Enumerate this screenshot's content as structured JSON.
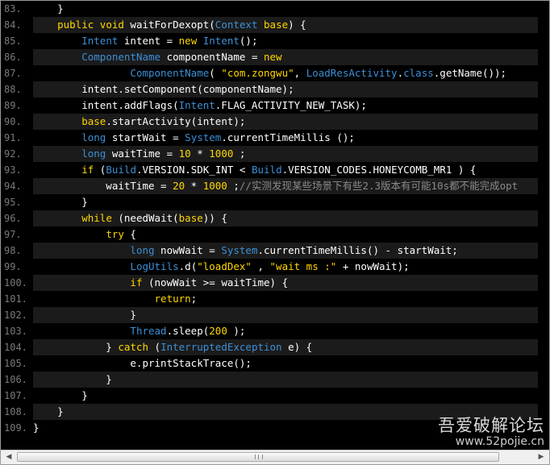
{
  "code": {
    "lines": [
      {
        "num": "83.",
        "tokens": [
          [
            "p",
            "    }"
          ]
        ]
      },
      {
        "num": "84.",
        "tokens": [
          [
            "p",
            "    "
          ],
          [
            "k",
            "public"
          ],
          [
            "p",
            " "
          ],
          [
            "k",
            "void"
          ],
          [
            "p",
            " waitForDexopt("
          ],
          [
            "t",
            "Context"
          ],
          [
            "p",
            " "
          ],
          [
            "k",
            "base"
          ],
          [
            "p",
            ") {"
          ]
        ]
      },
      {
        "num": "85.",
        "tokens": [
          [
            "p",
            "        "
          ],
          [
            "t",
            "Intent"
          ],
          [
            "p",
            " intent = "
          ],
          [
            "k",
            "new"
          ],
          [
            "p",
            " "
          ],
          [
            "t",
            "Intent"
          ],
          [
            "p",
            "();"
          ]
        ]
      },
      {
        "num": "86.",
        "tokens": [
          [
            "p",
            "        "
          ],
          [
            "t",
            "ComponentName"
          ],
          [
            "p",
            " componentName = "
          ],
          [
            "k",
            "new"
          ]
        ]
      },
      {
        "num": "87.",
        "tokens": [
          [
            "p",
            "                "
          ],
          [
            "t",
            "ComponentName"
          ],
          [
            "p",
            "( "
          ],
          [
            "s",
            "\"com.zongwu\""
          ],
          [
            "p",
            ", "
          ],
          [
            "t",
            "LoadResActivity"
          ],
          [
            "p",
            "."
          ],
          [
            "t",
            "class"
          ],
          [
            "p",
            ".getName());"
          ]
        ]
      },
      {
        "num": "88.",
        "tokens": [
          [
            "p",
            "        intent.setComponent(componentName);"
          ]
        ]
      },
      {
        "num": "89.",
        "tokens": [
          [
            "p",
            "        intent.addFlags("
          ],
          [
            "t",
            "Intent"
          ],
          [
            "p",
            ".FLAG_ACTIVITY_NEW_TASK);"
          ]
        ]
      },
      {
        "num": "90.",
        "tokens": [
          [
            "p",
            "        "
          ],
          [
            "k",
            "base"
          ],
          [
            "p",
            ".startActivity(intent);"
          ]
        ]
      },
      {
        "num": "91.",
        "tokens": [
          [
            "p",
            "        "
          ],
          [
            "t",
            "long"
          ],
          [
            "p",
            " startWait = "
          ],
          [
            "t",
            "System"
          ],
          [
            "p",
            ".currentTimeMillis ();"
          ]
        ]
      },
      {
        "num": "92.",
        "tokens": [
          [
            "p",
            "        "
          ],
          [
            "t",
            "long"
          ],
          [
            "p",
            " waitTime = "
          ],
          [
            "n",
            "10"
          ],
          [
            "p",
            " * "
          ],
          [
            "n",
            "1000"
          ],
          [
            "p",
            " ;"
          ]
        ]
      },
      {
        "num": "93.",
        "tokens": [
          [
            "p",
            "        "
          ],
          [
            "k",
            "if"
          ],
          [
            "p",
            " ("
          ],
          [
            "t",
            "Build"
          ],
          [
            "p",
            ".VERSION.SDK_INT < "
          ],
          [
            "t",
            "Build"
          ],
          [
            "p",
            ".VERSION_CODES.HONEYCOMB_MR1 ) {"
          ]
        ]
      },
      {
        "num": "94.",
        "tokens": [
          [
            "p",
            "            waitTime = "
          ],
          [
            "n",
            "20"
          ],
          [
            "p",
            " * "
          ],
          [
            "n",
            "1000"
          ],
          [
            "p",
            " ;"
          ],
          [
            "c",
            "//实测发现某些场景下有些2.3版本有可能10s都不能完成opt"
          ]
        ]
      },
      {
        "num": "95.",
        "tokens": [
          [
            "p",
            "        }"
          ]
        ]
      },
      {
        "num": "96.",
        "tokens": [
          [
            "p",
            "        "
          ],
          [
            "k",
            "while"
          ],
          [
            "p",
            " (needWait("
          ],
          [
            "k",
            "base"
          ],
          [
            "p",
            ")) {"
          ]
        ]
      },
      {
        "num": "97.",
        "tokens": [
          [
            "p",
            "            "
          ],
          [
            "k",
            "try"
          ],
          [
            "p",
            " {"
          ]
        ]
      },
      {
        "num": "98.",
        "tokens": [
          [
            "p",
            "                "
          ],
          [
            "t",
            "long"
          ],
          [
            "p",
            " nowWait = "
          ],
          [
            "t",
            "System"
          ],
          [
            "p",
            ".currentTimeMillis() - startWait;"
          ]
        ]
      },
      {
        "num": "99.",
        "tokens": [
          [
            "p",
            "                "
          ],
          [
            "t",
            "LogUtils"
          ],
          [
            "p",
            ".d("
          ],
          [
            "s",
            "\"loadDex\""
          ],
          [
            "p",
            " , "
          ],
          [
            "s",
            "\"wait ms :\""
          ],
          [
            "p",
            " + nowWait);"
          ]
        ]
      },
      {
        "num": "100.",
        "tokens": [
          [
            "p",
            "                "
          ],
          [
            "k",
            "if"
          ],
          [
            "p",
            " (nowWait >= waitTime) {"
          ]
        ]
      },
      {
        "num": "101.",
        "tokens": [
          [
            "p",
            "                    "
          ],
          [
            "k",
            "return"
          ],
          [
            "p",
            ";"
          ]
        ]
      },
      {
        "num": "102.",
        "tokens": [
          [
            "p",
            "                }"
          ]
        ]
      },
      {
        "num": "103.",
        "tokens": [
          [
            "p",
            "                "
          ],
          [
            "t",
            "Thread"
          ],
          [
            "p",
            ".sleep("
          ],
          [
            "n",
            "200"
          ],
          [
            "p",
            " );"
          ]
        ]
      },
      {
        "num": "104.",
        "tokens": [
          [
            "p",
            "            } "
          ],
          [
            "k",
            "catch"
          ],
          [
            "p",
            " ("
          ],
          [
            "t",
            "InterruptedException"
          ],
          [
            "p",
            " e) {"
          ]
        ]
      },
      {
        "num": "105.",
        "tokens": [
          [
            "p",
            "                e.printStackTrace();"
          ]
        ]
      },
      {
        "num": "106.",
        "tokens": [
          [
            "p",
            "            }"
          ]
        ]
      },
      {
        "num": "107.",
        "tokens": [
          [
            "p",
            "        }"
          ]
        ]
      },
      {
        "num": "108.",
        "tokens": [
          [
            "p",
            "    }"
          ]
        ]
      },
      {
        "num": "109.",
        "tokens": [
          [
            "p",
            "}"
          ]
        ]
      }
    ]
  },
  "scrollbar": {
    "left_arrow": "◀",
    "right_arrow": "▶"
  },
  "watermark": {
    "title": "吾爱破解论坛",
    "url": "www.52pojie.cn"
  },
  "colors": {
    "background": "#000000",
    "keyword": "#ffd700",
    "type": "#3d8fd6",
    "comment": "#8a8a8a",
    "plain": "#ffffff",
    "line_number": "#7a7a7a"
  }
}
